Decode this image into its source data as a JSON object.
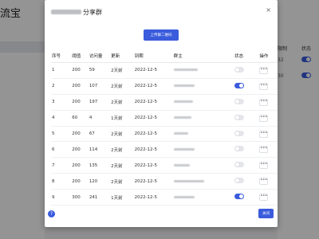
{
  "background": {
    "brand": "流宝",
    "right_headers": [
      "限制",
      "状态"
    ],
    "right_values": [
      "32",
      "30"
    ]
  },
  "modal": {
    "title_suffix": "分享群",
    "close_label": "×",
    "upload_button": "上传群二维码",
    "columns": [
      "序号",
      "阈值",
      "访问量",
      "更新",
      "到期",
      "群主",
      "状态",
      "操作"
    ],
    "rows": [
      {
        "id": "1",
        "threshold": "200",
        "visits": "59",
        "updated": "2天前",
        "expire": "2022-12-5",
        "owner_width": 30,
        "status": "off"
      },
      {
        "id": "2",
        "threshold": "200",
        "visits": "107",
        "updated": "2天前",
        "expire": "2022-12-5",
        "owner_width": 26,
        "status": "on"
      },
      {
        "id": "3",
        "threshold": "200",
        "visits": "197",
        "updated": "2天前",
        "expire": "2022-12-5",
        "owner_width": 24,
        "status": "off"
      },
      {
        "id": "4",
        "threshold": "60",
        "visits": "4",
        "updated": "1天前",
        "expire": "2022-12-5",
        "owner_width": 22,
        "status": "off"
      },
      {
        "id": "5",
        "threshold": "200",
        "visits": "67",
        "updated": "2天前",
        "expire": "2022-12-5",
        "owner_width": 18,
        "status": "off"
      },
      {
        "id": "6",
        "threshold": "200",
        "visits": "114",
        "updated": "2天前",
        "expire": "2022-12-5",
        "owner_width": 26,
        "status": "off"
      },
      {
        "id": "7",
        "threshold": "200",
        "visits": "135",
        "updated": "2天前",
        "expire": "2022-12-5",
        "owner_width": 20,
        "status": "off"
      },
      {
        "id": "8",
        "threshold": "200",
        "visits": "120",
        "updated": "2天前",
        "expire": "2022-12-5",
        "owner_width": 38,
        "status": "off"
      },
      {
        "id": "9",
        "threshold": "300",
        "visits": "241",
        "updated": "1天前",
        "expire": "2022-12-5",
        "owner_width": 26,
        "status": "on"
      }
    ],
    "more_label": "•••",
    "close_button": "关闭",
    "help_icon": "?"
  },
  "colors": {
    "accent": "#3a5bdc",
    "overlay": "rgba(0,0,0,0.42)"
  }
}
